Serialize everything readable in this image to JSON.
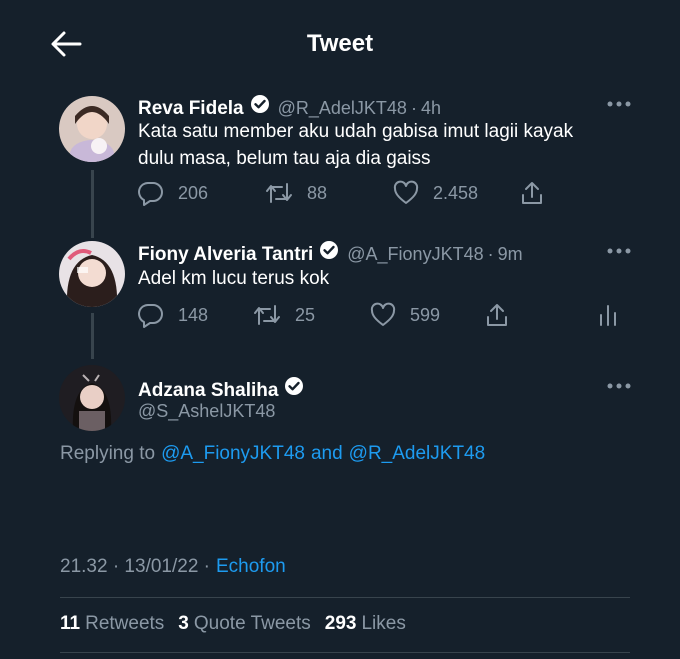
{
  "header": {
    "title": "Tweet"
  },
  "tweets": [
    {
      "name": "Reva Fidela",
      "handle": "@R_AdelJKT48",
      "time": "4h",
      "text_line1": "Kata satu member aku udah gabisa imut lagii kayak",
      "text_line2": "dulu masa, belum tau aja dia gaiss",
      "replies": "206",
      "retweets": "88",
      "likes": "2.458"
    },
    {
      "name": "Fiony Alveria Tantri",
      "handle": "@A_FionyJKT48",
      "time": "9m",
      "text_line1": "Adel km lucu terus kok",
      "replies": "148",
      "retweets": "25",
      "likes": "599"
    }
  ],
  "main": {
    "name": "Adzana Shaliha",
    "handle": "@S_AshelJKT48",
    "replying_prefix": "Replying to",
    "reply_to_1": "@A_FionyJKT48",
    "and": "and",
    "reply_to_2": "@R_AdelJKT48",
    "timestamp": "21.32 · 13/01/22 ·",
    "client": "Echofon",
    "retweet_count": "11",
    "retweet_label": "Retweets",
    "quote_count": "3",
    "quote_label": "Quote Tweets",
    "like_count": "293",
    "like_label": "Likes"
  },
  "icons": {
    "back": "arrow-left-icon",
    "verified": "verified-badge-icon",
    "reply": "reply-icon",
    "retweet": "retweet-icon",
    "like": "heart-icon",
    "share": "share-icon",
    "analytics": "analytics-icon",
    "more": "more-icon"
  },
  "colors": {
    "background": "#15202b",
    "accent": "#1d9bf0",
    "muted": "#8b98a5"
  }
}
